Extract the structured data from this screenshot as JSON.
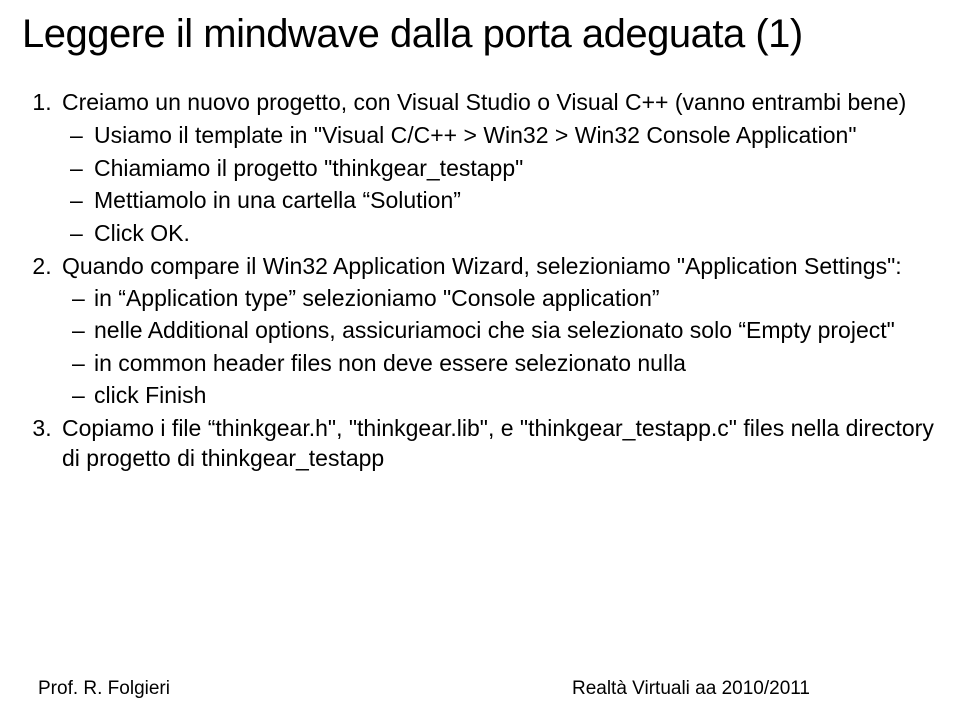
{
  "title": "Leggere il mindwave dalla porta adeguata (1)",
  "step1": {
    "lead": "Creiamo un nuovo progetto, con Visual Studio o Visual C++ (vanno entrambi bene)",
    "a": "Usiamo il template in \"Visual C/C++ > Win32 > Win32 Console Application\"",
    "b": "Chiamiamo il progetto \"thinkgear_testapp\"",
    "c": "Mettiamolo in una cartella “Solution”",
    "d": "Click OK."
  },
  "step2": {
    "lead": "Quando compare il Win32 Application Wizard, selezioniamo \"Application Settings\":",
    "a": "in “Application type” selezioniamo \"Console application”",
    "b": "nelle Additional options, assicuriamoci che sia selezionato solo “Empty project\"",
    "c": "in common header files non deve essere selezionato nulla",
    "d": "click Finish"
  },
  "step3": {
    "lead": "Copiamo i file “thinkgear.h\", \"thinkgear.lib\", e \"thinkgear_testapp.c\" files nella directory di progetto di thinkgear_testapp"
  },
  "footer": {
    "left": "Prof. R. Folgieri",
    "right": "Realtà Virtuali aa 2010/2011"
  }
}
